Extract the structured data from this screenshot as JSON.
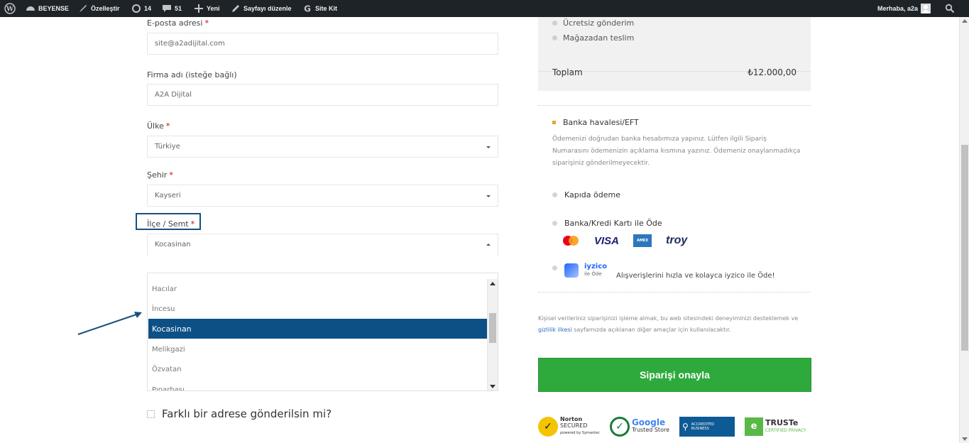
{
  "admin_bar": {
    "site_name": "BEYENSE",
    "customize": "Özelleştir",
    "updates_count": "14",
    "comments_count": "51",
    "new_label": "Yeni",
    "edit_page": "Sayfayı düzenle",
    "site_kit": "Site Kit",
    "greeting": "Merhaba, a2a"
  },
  "form": {
    "email": {
      "label": "E-posta adresi",
      "required": "*",
      "value": "site@a2adijital.com"
    },
    "company": {
      "label": "Firma adı (isteğe bağlı)",
      "value": "A2A Dijital"
    },
    "country": {
      "label": "Ülke",
      "required": "*",
      "value": "Türkiye"
    },
    "city": {
      "label": "Şehir",
      "required": "*",
      "value": "Kayseri"
    },
    "district": {
      "label": "İlçe / Semt",
      "required": "*",
      "value": "Kocasinan"
    },
    "district_options": [
      "Hacılar",
      "İncesu",
      "Kocasinan",
      "Melikgazi",
      "Özvatan",
      "Pınarbaşı"
    ],
    "selected_option": "Kocasinan",
    "ship_different": "Farklı bir adrese gönderilsin mi?"
  },
  "order": {
    "shipping_options": [
      "Ücretsiz gönderim",
      "Mağazadan teslim"
    ],
    "total_label": "Toplam",
    "total_value": "₺12.000,00"
  },
  "payment": {
    "bank_transfer": {
      "label": "Banka havalesi/EFT",
      "description": "Ödemenizi doğrudan banka hesabımıza yapınız. Lütfen ilgili Sipariş Numarasını ödemenizin açıklama kısmına yazınız. Ödemeniz onaylanmadıkça siparişiniz gönderilmeyecektir."
    },
    "cash_on_delivery": "Kapıda ödeme",
    "card": "Banka/Kredi Kartı ile Öde",
    "card_brands": [
      "VISA",
      "troy"
    ],
    "iyzico": {
      "name": "iyzico",
      "sub": "ile Öde",
      "description": "Alışverişlerini hızla ve kolayca iyzico ile Öde!"
    }
  },
  "privacy": {
    "text_before": "Kişisel verileriniz siparişinizi işleme almak, bu web sitesindeki deneyiminizi desteklemek ve ",
    "link": "gizlilik ilkesi",
    "text_after": " sayfamızda açıklanan diğer amaçlar için kullanılacaktır."
  },
  "confirm_button": "Siparişi onayla",
  "trust_badges": {
    "norton": {
      "line1": "Norton",
      "line2": "SECURED",
      "line3": "powered by Symantec"
    },
    "google": {
      "line1": "Google",
      "line2": "Trusted Store"
    },
    "bbb": {
      "line1": "ACCREDITED",
      "line2": "BUSINESS"
    },
    "truste": {
      "line1": "TRUSTe",
      "line2": "CERTIFIED PRIVACY"
    }
  },
  "colors": {
    "admin_bar": "#1d2327",
    "selected_option": "#0d5086",
    "confirm_button": "#2eaa3c",
    "annotation_arrow": "#1c4f7c"
  }
}
